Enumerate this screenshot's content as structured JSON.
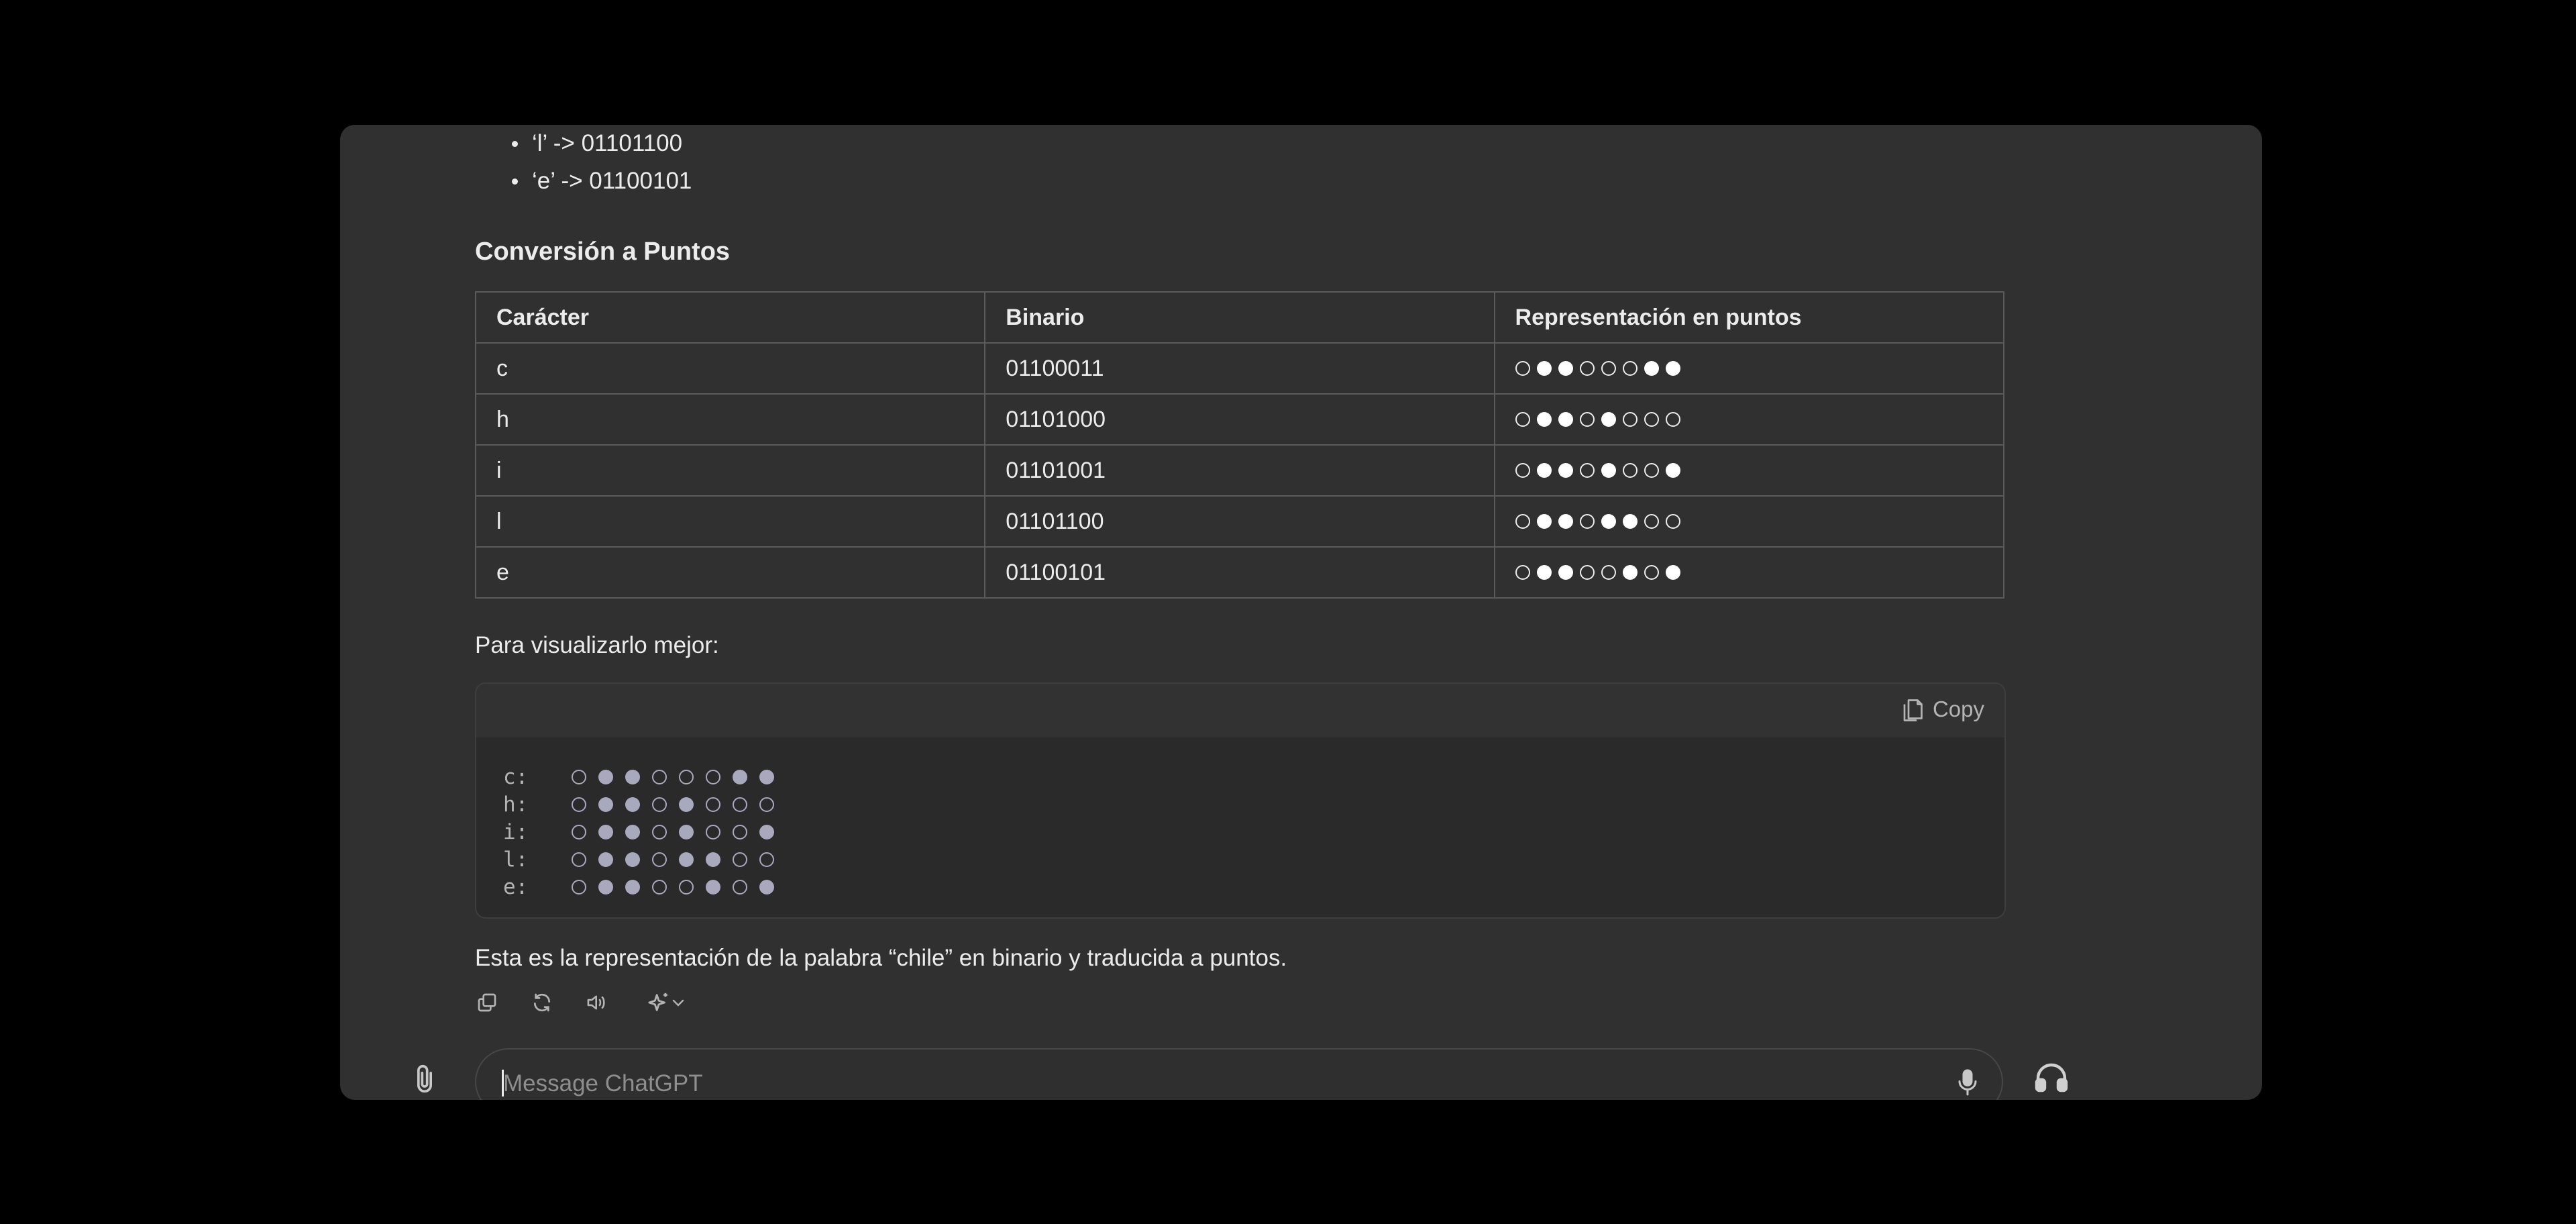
{
  "bullets": [
    "‘l’ -> 01101100",
    "‘e’ -> 01100101"
  ],
  "section_title": "Conversión a Puntos",
  "table": {
    "headers": [
      "Carácter",
      "Binario",
      "Representación en puntos"
    ],
    "rows": [
      {
        "char": "c",
        "binary": "01100011",
        "bits": [
          0,
          1,
          1,
          0,
          0,
          0,
          1,
          1
        ]
      },
      {
        "char": "h",
        "binary": "01101000",
        "bits": [
          0,
          1,
          1,
          0,
          1,
          0,
          0,
          0
        ]
      },
      {
        "char": "i",
        "binary": "01101001",
        "bits": [
          0,
          1,
          1,
          0,
          1,
          0,
          0,
          1
        ]
      },
      {
        "char": "l",
        "binary": "01101100",
        "bits": [
          0,
          1,
          1,
          0,
          1,
          1,
          0,
          0
        ]
      },
      {
        "char": "e",
        "binary": "01100101",
        "bits": [
          0,
          1,
          1,
          0,
          0,
          1,
          0,
          1
        ]
      }
    ]
  },
  "visualize_label": "Para visualizarlo mejor:",
  "code_block": {
    "copy_label": "Copy",
    "rows": [
      {
        "label": "c:",
        "bits": [
          0,
          1,
          1,
          0,
          0,
          0,
          1,
          1
        ]
      },
      {
        "label": "h:",
        "bits": [
          0,
          1,
          1,
          0,
          1,
          0,
          0,
          0
        ]
      },
      {
        "label": "i:",
        "bits": [
          0,
          1,
          1,
          0,
          1,
          0,
          0,
          1
        ]
      },
      {
        "label": "l:",
        "bits": [
          0,
          1,
          1,
          0,
          1,
          1,
          0,
          0
        ]
      },
      {
        "label": "e:",
        "bits": [
          0,
          1,
          1,
          0,
          0,
          1,
          0,
          1
        ]
      }
    ]
  },
  "summary": "Esta es la representación de la palabra “chile” en binario y traducida a puntos.",
  "message_actions": [
    "copy-icon",
    "regenerate-icon",
    "read-aloud-icon",
    "sparkle-model-icon",
    "chevron-down-icon"
  ],
  "composer": {
    "placeholder": "Message ChatGPT"
  },
  "colors": {
    "page_bg": "#000000",
    "window_bg": "#303030",
    "text": "#ececec",
    "code_dot": "#a9a9bd"
  }
}
